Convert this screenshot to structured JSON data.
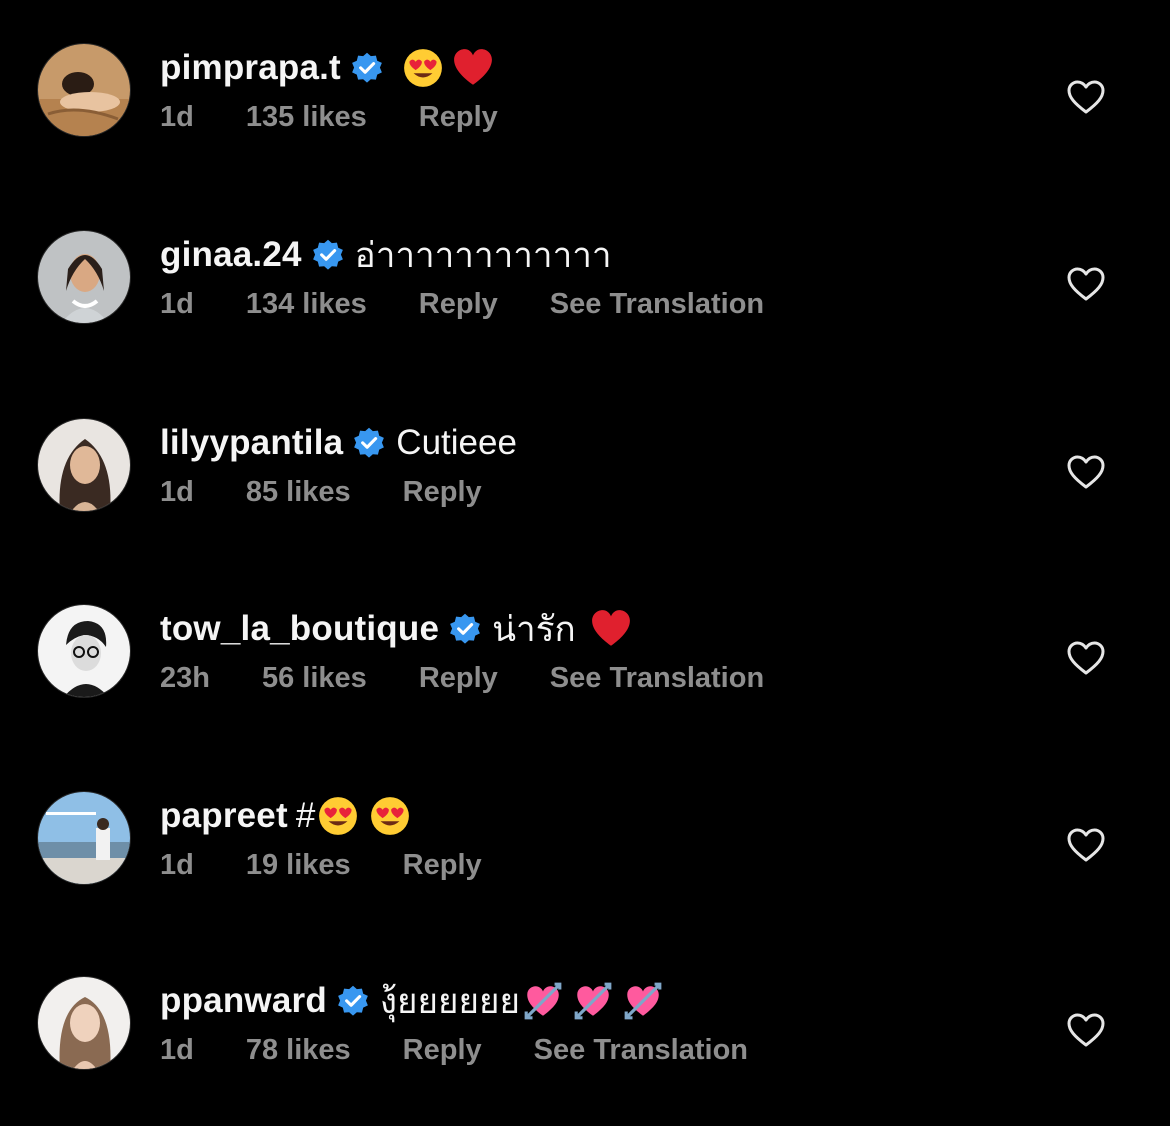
{
  "comments": [
    {
      "username": "pimprapa.t",
      "verified": true,
      "text": "",
      "emojis": [
        "heart-eyes-emoji",
        "red-heart-emoji"
      ],
      "time": "1d",
      "likes": "135 likes",
      "reply": "Reply",
      "translation": ""
    },
    {
      "username": "ginaa.24",
      "verified": true,
      "text": "อ่าาาาาาาาาาาา",
      "emojis": [],
      "time": "1d",
      "likes": "134 likes",
      "reply": "Reply",
      "translation": "See Translation"
    },
    {
      "username": "lilyypantila",
      "verified": true,
      "text": "Cutieee",
      "emojis": [],
      "time": "1d",
      "likes": "85 likes",
      "reply": "Reply",
      "translation": ""
    },
    {
      "username": "tow_la_boutique",
      "verified": true,
      "text": "น่ารัก",
      "emojis": [
        "red-heart-emoji"
      ],
      "time": "23h",
      "likes": "56 likes",
      "reply": "Reply",
      "translation": "See Translation"
    },
    {
      "username": "papreet",
      "verified": false,
      "text": "#",
      "emojis": [
        "heart-eyes-emoji",
        "heart-eyes-emoji"
      ],
      "time": "1d",
      "likes": "19 likes",
      "reply": "Reply",
      "translation": ""
    },
    {
      "username": "ppanward",
      "verified": true,
      "text": "งุ้ยยยยยย",
      "emojis": [
        "heart-with-arrow-emoji",
        "heart-with-arrow-emoji",
        "heart-with-arrow-emoji"
      ],
      "time": "1d",
      "likes": "78 likes",
      "reply": "Reply",
      "translation": "See Translation"
    }
  ],
  "colors": {
    "background": "#000000",
    "primary_text": "#f5f5f5",
    "secondary_text": "#8e8e8e",
    "verified_badge": "#3897f0",
    "red_heart": "#e0202e",
    "emoji_face": "#ffcc33",
    "pink_heart": "#ff5a9e"
  },
  "icons": {
    "like": "heart-outline-icon",
    "verified": "verified-badge-icon"
  }
}
